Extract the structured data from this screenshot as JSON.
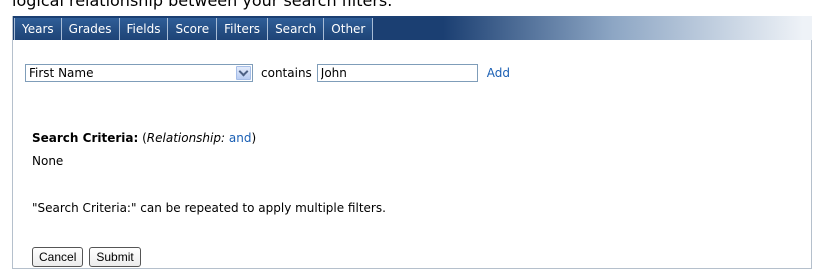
{
  "intro_text": "logical relationship between your search filters.",
  "tabs": [
    {
      "label": "Years"
    },
    {
      "label": "Grades"
    },
    {
      "label": "Fields"
    },
    {
      "label": "Score"
    },
    {
      "label": "Filters"
    },
    {
      "label": "Search"
    },
    {
      "label": "Other"
    }
  ],
  "filter": {
    "field_selected": "First Name",
    "operator_label": "contains",
    "value": "John",
    "add_label": "Add"
  },
  "criteria": {
    "heading": "Search Criteria:",
    "open_paren": " (",
    "relationship_label": "Relationship:",
    "relationship_value": "and",
    "close_paren": ")",
    "current": "None"
  },
  "note": "\"Search Criteria:\" can be repeated to apply multiple filters.",
  "buttons": {
    "cancel": "Cancel",
    "submit": "Submit"
  },
  "colors": {
    "tab_bg": "#244d82",
    "link": "#1a5fb4",
    "panel_border": "#b5c0cc"
  },
  "icons": {
    "select_arrow": "chevron-down-icon"
  }
}
